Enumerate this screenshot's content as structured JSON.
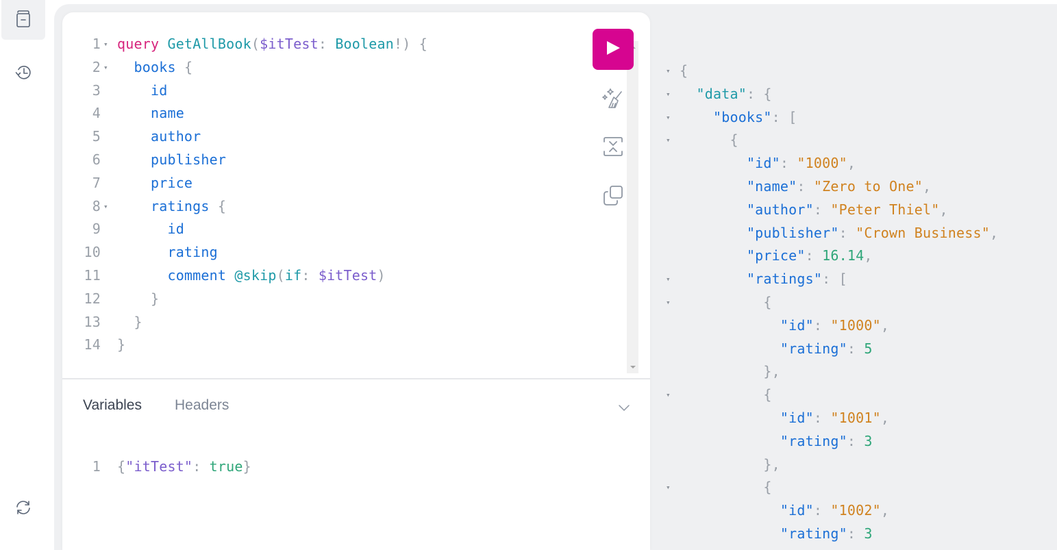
{
  "sidebar": {
    "top_items": [
      {
        "name": "docs-explorer",
        "icon": "book-icon",
        "active": true
      },
      {
        "name": "history",
        "icon": "history-icon",
        "active": false
      }
    ],
    "bottom_items": [
      {
        "name": "refetch-schema",
        "icon": "refresh-icon"
      }
    ]
  },
  "query_editor": {
    "lines": [
      {
        "n": "1",
        "fold": true,
        "tokens": [
          [
            "kw",
            "query"
          ],
          [
            "txt",
            " "
          ],
          [
            "def",
            "GetAllBook"
          ],
          [
            "punct",
            "("
          ],
          [
            "var",
            "$itTest"
          ],
          [
            "punct",
            ": "
          ],
          [
            "type",
            "Boolean"
          ],
          [
            "punct",
            "!) {"
          ]
        ]
      },
      {
        "n": "2",
        "fold": true,
        "tokens": [
          [
            "txt",
            "  "
          ],
          [
            "field",
            "books"
          ],
          [
            "punct",
            " {"
          ]
        ]
      },
      {
        "n": "3",
        "fold": false,
        "tokens": [
          [
            "txt",
            "    "
          ],
          [
            "field",
            "id"
          ]
        ]
      },
      {
        "n": "4",
        "fold": false,
        "tokens": [
          [
            "txt",
            "    "
          ],
          [
            "field",
            "name"
          ]
        ]
      },
      {
        "n": "5",
        "fold": false,
        "tokens": [
          [
            "txt",
            "    "
          ],
          [
            "field",
            "author"
          ]
        ]
      },
      {
        "n": "6",
        "fold": false,
        "tokens": [
          [
            "txt",
            "    "
          ],
          [
            "field",
            "publisher"
          ]
        ]
      },
      {
        "n": "7",
        "fold": false,
        "tokens": [
          [
            "txt",
            "    "
          ],
          [
            "field",
            "price"
          ]
        ]
      },
      {
        "n": "8",
        "fold": true,
        "tokens": [
          [
            "txt",
            "    "
          ],
          [
            "field",
            "ratings"
          ],
          [
            "punct",
            " {"
          ]
        ]
      },
      {
        "n": "9",
        "fold": false,
        "tokens": [
          [
            "txt",
            "      "
          ],
          [
            "field",
            "id"
          ]
        ]
      },
      {
        "n": "10",
        "fold": false,
        "tokens": [
          [
            "txt",
            "      "
          ],
          [
            "field",
            "rating"
          ]
        ]
      },
      {
        "n": "11",
        "fold": false,
        "tokens": [
          [
            "txt",
            "      "
          ],
          [
            "field",
            "comment"
          ],
          [
            "txt",
            " "
          ],
          [
            "dir",
            "@skip"
          ],
          [
            "punct",
            "("
          ],
          [
            "arg",
            "if"
          ],
          [
            "punct",
            ": "
          ],
          [
            "var",
            "$itTest"
          ],
          [
            "punct",
            ")"
          ]
        ]
      },
      {
        "n": "12",
        "fold": false,
        "tokens": [
          [
            "txt",
            "    "
          ],
          [
            "punct",
            "}"
          ]
        ]
      },
      {
        "n": "13",
        "fold": false,
        "tokens": [
          [
            "txt",
            "  "
          ],
          [
            "punct",
            "}"
          ]
        ]
      },
      {
        "n": "14",
        "fold": false,
        "tokens": [
          [
            "punct",
            "}"
          ]
        ]
      }
    ]
  },
  "toolbar": {
    "run_label": "Execute query",
    "prettify_label": "Prettify query",
    "merge_label": "Merge fragments into query",
    "copy_label": "Copy query"
  },
  "bottom_panel": {
    "tabs": [
      {
        "label": "Variables",
        "active": true
      },
      {
        "label": "Headers",
        "active": false
      }
    ],
    "variables_lines": [
      {
        "n": "1",
        "tokens": [
          [
            "punct",
            "{"
          ],
          [
            "var",
            "\"itTest\""
          ],
          [
            "punct",
            ": "
          ],
          [
            "bool",
            "true"
          ],
          [
            "punct",
            "}"
          ]
        ]
      }
    ]
  },
  "result": {
    "lines": [
      {
        "fold": true,
        "tokens": [
          [
            "punct",
            "{"
          ]
        ]
      },
      {
        "fold": true,
        "tokens": [
          [
            "txt",
            "  "
          ],
          [
            "def",
            "\"data\""
          ],
          [
            "punct",
            ": {"
          ]
        ]
      },
      {
        "fold": true,
        "tokens": [
          [
            "txt",
            "    "
          ],
          [
            "field",
            "\"books\""
          ],
          [
            "punct",
            ": ["
          ]
        ]
      },
      {
        "fold": true,
        "tokens": [
          [
            "txt",
            "      "
          ],
          [
            "punct",
            "{"
          ]
        ]
      },
      {
        "fold": false,
        "tokens": [
          [
            "txt",
            "        "
          ],
          [
            "field",
            "\"id\""
          ],
          [
            "punct",
            ": "
          ],
          [
            "str",
            "\"1000\""
          ],
          [
            "punct",
            ","
          ]
        ]
      },
      {
        "fold": false,
        "tokens": [
          [
            "txt",
            "        "
          ],
          [
            "field",
            "\"name\""
          ],
          [
            "punct",
            ": "
          ],
          [
            "str",
            "\"Zero to One\""
          ],
          [
            "punct",
            ","
          ]
        ]
      },
      {
        "fold": false,
        "tokens": [
          [
            "txt",
            "        "
          ],
          [
            "field",
            "\"author\""
          ],
          [
            "punct",
            ": "
          ],
          [
            "str",
            "\"Peter Thiel\""
          ],
          [
            "punct",
            ","
          ]
        ]
      },
      {
        "fold": false,
        "tokens": [
          [
            "txt",
            "        "
          ],
          [
            "field",
            "\"publisher\""
          ],
          [
            "punct",
            ": "
          ],
          [
            "str",
            "\"Crown Business\""
          ],
          [
            "punct",
            ","
          ]
        ]
      },
      {
        "fold": false,
        "tokens": [
          [
            "txt",
            "        "
          ],
          [
            "field",
            "\"price\""
          ],
          [
            "punct",
            ": "
          ],
          [
            "num",
            "16.14"
          ],
          [
            "punct",
            ","
          ]
        ]
      },
      {
        "fold": true,
        "tokens": [
          [
            "txt",
            "        "
          ],
          [
            "field",
            "\"ratings\""
          ],
          [
            "punct",
            ": ["
          ]
        ]
      },
      {
        "fold": true,
        "tokens": [
          [
            "txt",
            "          "
          ],
          [
            "punct",
            "{"
          ]
        ]
      },
      {
        "fold": false,
        "tokens": [
          [
            "txt",
            "            "
          ],
          [
            "field",
            "\"id\""
          ],
          [
            "punct",
            ": "
          ],
          [
            "str",
            "\"1000\""
          ],
          [
            "punct",
            ","
          ]
        ]
      },
      {
        "fold": false,
        "tokens": [
          [
            "txt",
            "            "
          ],
          [
            "field",
            "\"rating\""
          ],
          [
            "punct",
            ": "
          ],
          [
            "num",
            "5"
          ]
        ]
      },
      {
        "fold": false,
        "tokens": [
          [
            "txt",
            "          "
          ],
          [
            "punct",
            "},"
          ]
        ]
      },
      {
        "fold": true,
        "tokens": [
          [
            "txt",
            "          "
          ],
          [
            "punct",
            "{"
          ]
        ]
      },
      {
        "fold": false,
        "tokens": [
          [
            "txt",
            "            "
          ],
          [
            "field",
            "\"id\""
          ],
          [
            "punct",
            ": "
          ],
          [
            "str",
            "\"1001\""
          ],
          [
            "punct",
            ","
          ]
        ]
      },
      {
        "fold": false,
        "tokens": [
          [
            "txt",
            "            "
          ],
          [
            "field",
            "\"rating\""
          ],
          [
            "punct",
            ": "
          ],
          [
            "num",
            "3"
          ]
        ]
      },
      {
        "fold": false,
        "tokens": [
          [
            "txt",
            "          "
          ],
          [
            "punct",
            "},"
          ]
        ]
      },
      {
        "fold": true,
        "tokens": [
          [
            "txt",
            "          "
          ],
          [
            "punct",
            "{"
          ]
        ]
      },
      {
        "fold": false,
        "tokens": [
          [
            "txt",
            "            "
          ],
          [
            "field",
            "\"id\""
          ],
          [
            "punct",
            ": "
          ],
          [
            "str",
            "\"1002\""
          ],
          [
            "punct",
            ","
          ]
        ]
      },
      {
        "fold": false,
        "tokens": [
          [
            "txt",
            "            "
          ],
          [
            "field",
            "\"rating\""
          ],
          [
            "punct",
            ": "
          ],
          [
            "num",
            "3"
          ]
        ]
      }
    ]
  },
  "colors": {
    "accent": "#d60590",
    "keyword": "#d6247c",
    "field": "#1b6fd6",
    "definition": "#1f9aa8",
    "variable": "#7b5dcc",
    "string": "#d0821f",
    "number": "#2fa679",
    "punctuation": "#9aa0a8",
    "icon": "#5b6677"
  }
}
